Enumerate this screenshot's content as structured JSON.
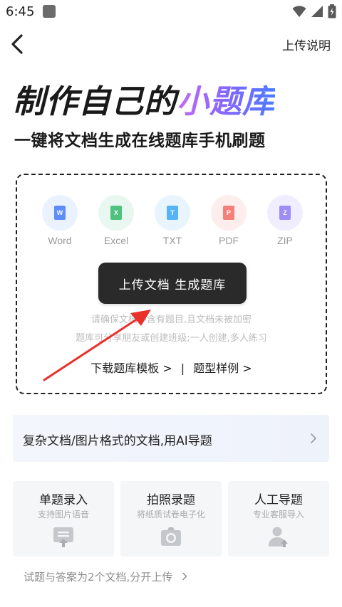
{
  "status_bar": {
    "time": "6:45"
  },
  "header": {
    "back_icon": "chevron-left-icon",
    "help_label": "上传说明"
  },
  "hero": {
    "title_part1": "制作自己的",
    "title_part2": "小题库",
    "subtitle": "一键将文档生成在线题库手机刷题"
  },
  "upload": {
    "file_types": [
      {
        "label": "Word",
        "glyph": "W",
        "color": "#5d8dfb",
        "bg": "#eaf1ff"
      },
      {
        "label": "Excel",
        "glyph": "X",
        "color": "#4ec27f",
        "bg": "#e8f7ef"
      },
      {
        "label": "TXT",
        "glyph": "T",
        "color": "#56b3f5",
        "bg": "#e8f5fe"
      },
      {
        "label": "PDF",
        "glyph": "P",
        "color": "#f4807a",
        "bg": "#fdeeed"
      },
      {
        "label": "ZIP",
        "glyph": "Z",
        "color": "#9d8df6",
        "bg": "#f0eefe"
      }
    ],
    "button_label": "上传文档 生成题库",
    "notice_1": "请确保文档中含有题目,且文档未被加密",
    "notice_2": "题库可分享朋友或创建班级;一人创建,多人练习",
    "download_template": "下载题库模板 >",
    "separator": "|",
    "question_examples": "题型样例 >"
  },
  "ai_banner": {
    "label": "复杂文档/图片格式的文档,用AI导题"
  },
  "cards": [
    {
      "title": "单题录入",
      "subtitle": "支持图片语音",
      "icon": "chat-upload-icon"
    },
    {
      "title": "拍照录题",
      "subtitle": "将纸质试卷电子化",
      "icon": "camera-icon"
    },
    {
      "title": "人工导题",
      "subtitle": "专业客服导入",
      "icon": "person-upload-icon"
    }
  ],
  "footer": {
    "link_label": "试题与答案为2个文档,分开上传"
  },
  "colors": {
    "accent_gradient_start": "#c36cf0",
    "accent_gradient_end": "#4d7cff",
    "button_bg": "#2a2a2a",
    "annotation_arrow": "#e8312a"
  }
}
